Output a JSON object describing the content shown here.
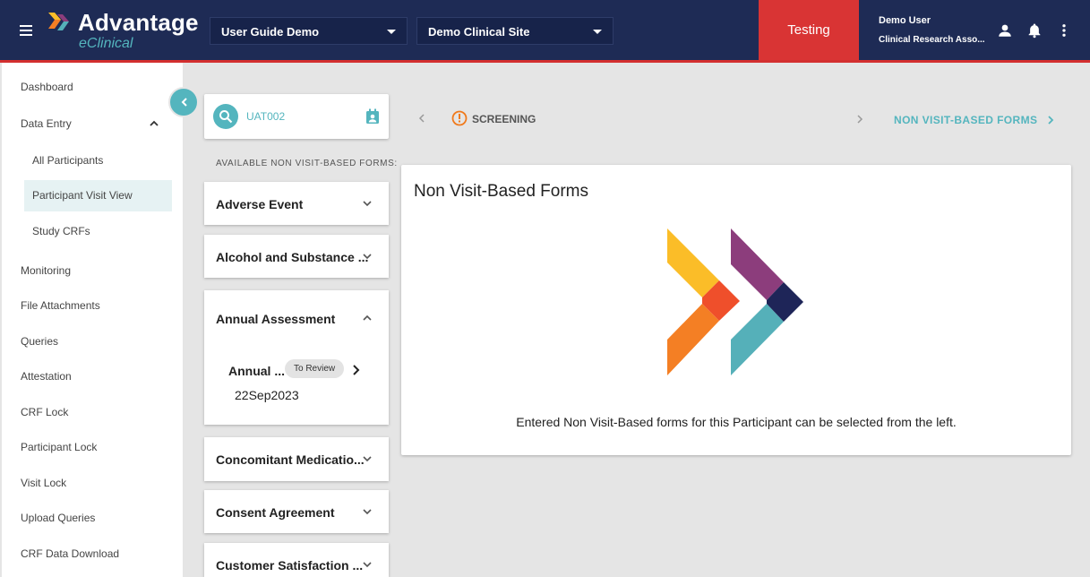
{
  "header": {
    "app_name": "Advantage",
    "app_sub": "eClinical",
    "study_select": "User Guide Demo",
    "site_select": "Demo Clinical Site",
    "environment": "Testing",
    "user_name": "Demo User",
    "user_role": "Clinical Research Asso...",
    "icons": [
      "menu-icon",
      "person-icon",
      "bell-icon",
      "more-vert-icon"
    ]
  },
  "sidebar": {
    "items": [
      {
        "label": "Dashboard"
      },
      {
        "label": "Data Entry"
      },
      {
        "label": "All Participants"
      },
      {
        "label": "Participant Visit View"
      },
      {
        "label": "Study CRFs"
      },
      {
        "label": "Monitoring"
      },
      {
        "label": "File Attachments"
      },
      {
        "label": "Queries"
      },
      {
        "label": "Attestation"
      },
      {
        "label": "CRF Lock"
      },
      {
        "label": "Participant Lock"
      },
      {
        "label": "Visit Lock"
      },
      {
        "label": "Upload Queries"
      },
      {
        "label": "CRF Data Download"
      }
    ],
    "active": "Participant Visit View"
  },
  "participant": {
    "id": "UAT002",
    "available_label": "AVAILABLE NON VISIT-BASED FORMS:"
  },
  "forms": [
    {
      "title": "Adverse Event"
    },
    {
      "title": "Alcohol and Substance ..."
    },
    {
      "title": "Annual Assessment",
      "expanded": true,
      "entry": {
        "name": "Annual ...",
        "status": "To Review",
        "date": "22Sep2023"
      }
    },
    {
      "title": "Concomitant Medicatio..."
    },
    {
      "title": "Consent Agreement"
    },
    {
      "title": "Customer Satisfaction ..."
    }
  ],
  "visit_nav": {
    "current": "SCREENING",
    "next_link": "NON VISIT-BASED FORMS"
  },
  "panel": {
    "title": "Non Visit-Based Forms",
    "message": "Entered Non Visit-Based forms for this Participant can be selected from the left."
  },
  "colors": {
    "header_bg": "#1e2b55",
    "accent": "#54b5be",
    "env_red": "#d93434",
    "logo_yellow": "#fbbd28",
    "logo_orange": "#f47f24",
    "logo_red": "#ef4f2b",
    "logo_purple": "#8c3d7c",
    "logo_teal": "#55b0b9",
    "logo_navy": "#1e2558"
  }
}
